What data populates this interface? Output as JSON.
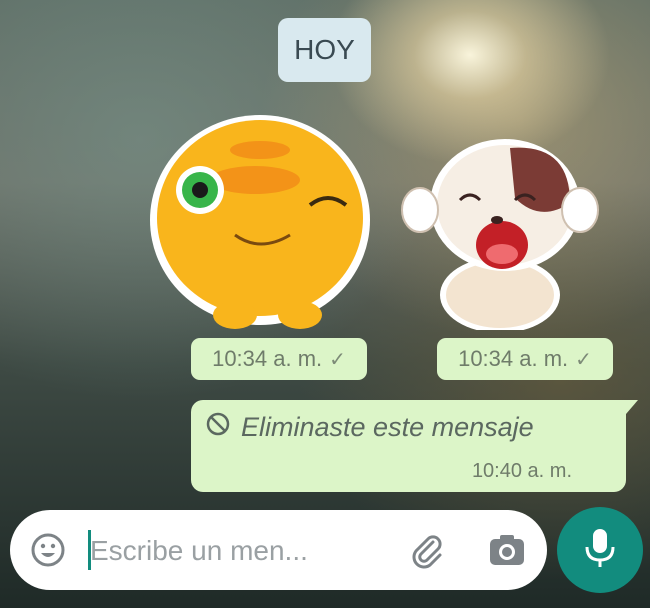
{
  "chat": {
    "day_label": "HOY",
    "stickers": [
      {
        "icon": "yellow-ball-sticker",
        "time": "10:34 a. m.",
        "status": "✓"
      },
      {
        "icon": "puppy-sticker",
        "time": "10:34 a. m.",
        "status": "✓"
      }
    ],
    "deleted_message": {
      "icon": "prohibited-icon",
      "text": "Eliminaste este mensaje",
      "time": "10:40 a. m."
    }
  },
  "composer": {
    "placeholder": "Escribe un men...",
    "icons": [
      "emoji-icon",
      "paperclip-icon",
      "camera-icon",
      "microphone-icon"
    ]
  },
  "colors": {
    "bubble": "#dcf5c8",
    "day_chip": "#d9e9ef",
    "accent": "#128c7e"
  }
}
